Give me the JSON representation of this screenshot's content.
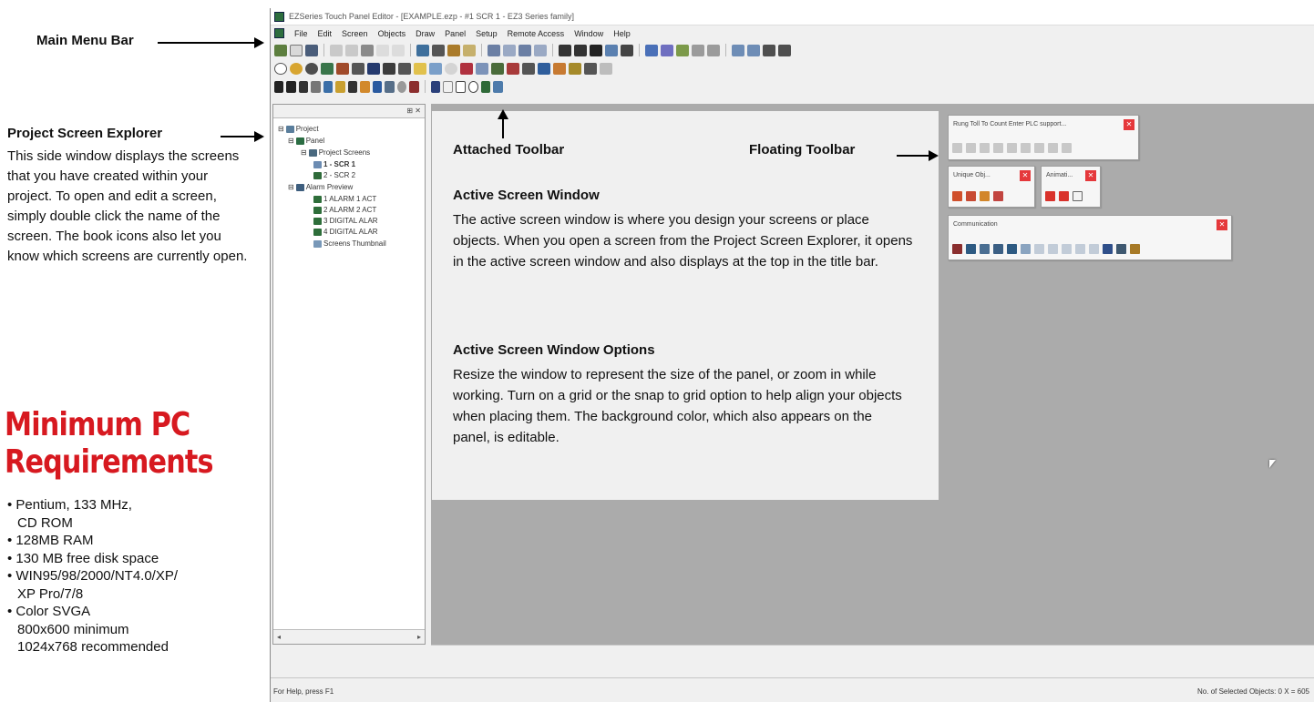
{
  "annotations": {
    "main_menu_bar": "Main Menu Bar",
    "project_explorer_title": "Project Screen Explorer",
    "project_explorer_body": "This side window displays the screens that you have created within your project. To open and edit a screen, simply double click the name of the screen. The book icons also let you know which screens are currently open.",
    "attached_toolbar": "Attached Toolbar",
    "floating_toolbar": "Floating Toolbar",
    "active_window_title": "Active Screen Window",
    "active_window_body": "The active screen window is where you design your screens or place objects. When you open a screen from the Project Screen Explorer, it opens in the active screen window and also displays at the top in the title bar.",
    "options_title": "Active Screen Window Options",
    "options_body": "Resize the window to represent the size of the panel, or zoom in while working. Turn on a grid or the snap to grid option to help align your objects when placing them. The background color, which also appears on the panel, is editable."
  },
  "requirements": {
    "title": "Minimum PC Requirements",
    "title_color": "#d71920",
    "items": [
      "Pentium, 133 MHz,\nCD ROM",
      "128MB RAM",
      "130 MB free disk space",
      "WIN95/98/2000/NT4.0/XP/\nXP Pro/7/8",
      "Color SVGA\n800x600 minimum\n1024x768 recommended"
    ]
  },
  "app": {
    "title": "EZSeries Touch Panel Editor - [EXAMPLE.ezp - #1 SCR 1 - EZ3 Series family]",
    "menu": [
      "File",
      "Edit",
      "Screen",
      "Objects",
      "Draw",
      "Panel",
      "Setup",
      "Remote Access",
      "Window",
      "Help"
    ],
    "explorer": {
      "pin_icon": "pin-icon",
      "tree": [
        {
          "label": "Project",
          "icon": "project-icon"
        },
        {
          "label": "Panel",
          "icon": "panel-icon"
        },
        {
          "label": "Project Screens",
          "icon": "screens-icon"
        },
        {
          "label": "1 - SCR 1",
          "icon": "open-book-icon"
        },
        {
          "label": "2 - SCR 2",
          "icon": "book-icon"
        },
        {
          "label": "Alarm Preview",
          "icon": "alarm-icon"
        },
        {
          "label": "1 ALARM 1 ACT",
          "icon": "alarm-item-icon"
        },
        {
          "label": "2 ALARM 2 ACT",
          "icon": "alarm-item-icon"
        },
        {
          "label": "3 DIGITAL ALAR",
          "icon": "alarm-item-icon"
        },
        {
          "label": "4 DIGITAL ALAR",
          "icon": "alarm-item-icon"
        },
        {
          "label": "Screens Thumbnail",
          "icon": "thumbnail-icon"
        }
      ]
    },
    "floating_toolbars": {
      "rung": "Rung Toll To Count Enter PLC support...",
      "unique": "Unique Obj...",
      "animation": "Animati...",
      "communication": "Communication"
    },
    "status_left": "For Help, press F1",
    "status_right": "No. of Selected Objects: 0     X = 605"
  }
}
